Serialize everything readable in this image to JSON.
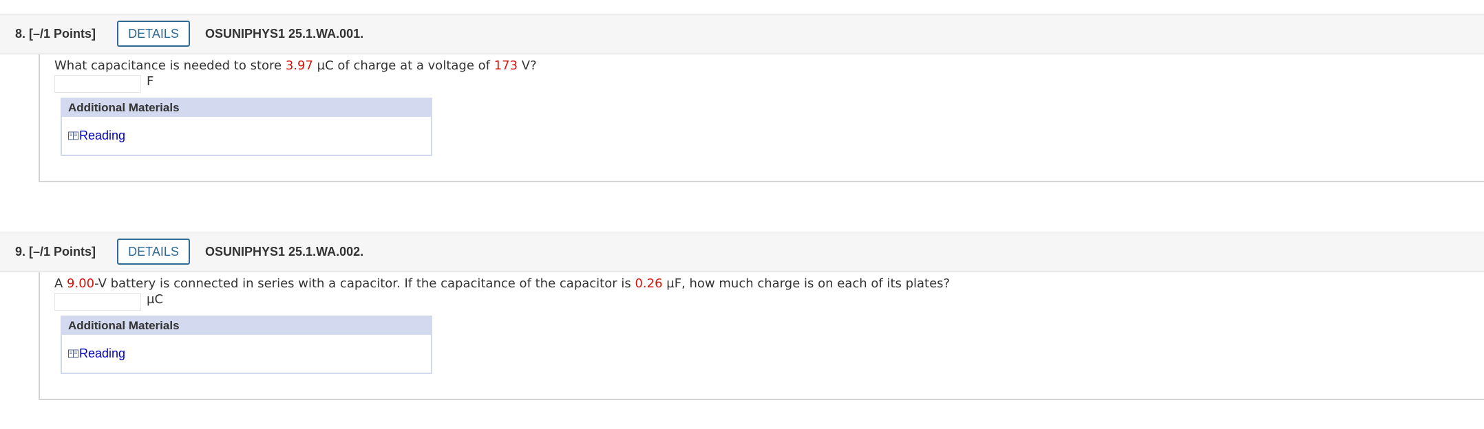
{
  "questions": [
    {
      "points": "8. [–/1 Points]",
      "details_label": "DETAILS",
      "id": "OSUNIPHYS1 25.1.WA.001.",
      "text_parts": [
        "What capacitance is needed to store ",
        "3.97",
        " µC of charge at a voltage of ",
        "173",
        " V?"
      ],
      "answer_value": "",
      "unit": "F",
      "materials_title": "Additional Materials",
      "reading_label": "Reading"
    },
    {
      "points": "9. [–/1 Points]",
      "details_label": "DETAILS",
      "id": "OSUNIPHYS1 25.1.WA.002.",
      "text_parts": [
        "A ",
        "9.00",
        "-V battery is connected in series with a capacitor. If the capacitance of the capacitor is ",
        "0.26",
        " µF, how much charge is on each of its plates?"
      ],
      "answer_value": "",
      "unit": "µC",
      "materials_title": "Additional Materials",
      "reading_label": "Reading"
    }
  ],
  "icons": {
    "reading": "book-icon"
  },
  "colors": {
    "randomized_value": "#d5150b",
    "details_button": "#2f6a94",
    "link": "#0000cc",
    "materials_header": "#d3d9ef"
  }
}
